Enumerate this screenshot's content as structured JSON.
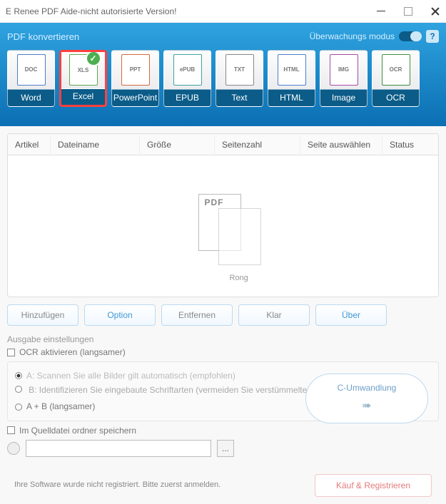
{
  "title_bar": {
    "title": "E Renee PDF Aide-nicht autorisierte Version!"
  },
  "ribbon": {
    "title": "PDF konvertieren",
    "monitor_label": "Überwachungs modus",
    "help_icon": "?",
    "tiles": [
      {
        "label": "Word",
        "short": "DOC"
      },
      {
        "label": "Excel",
        "short": "XLS",
        "selected": true
      },
      {
        "label": "PowerPoint",
        "short": "PPT"
      },
      {
        "label": "EPUB",
        "short": "ePUB"
      },
      {
        "label": "Text",
        "short": "TXT"
      },
      {
        "label": "HTML",
        "short": "HTML"
      },
      {
        "label": "Image",
        "short": "IMG"
      },
      {
        "label": "OCR",
        "short": "OCR"
      }
    ]
  },
  "table": {
    "headers": {
      "article": "Artikel",
      "filename": "Dateiname",
      "size": "Größe",
      "pagecount": "Seitenzahl",
      "selectpage": "Seite auswählen",
      "status": "Status"
    },
    "placeholder_text": "Rong",
    "pdf_tag": "PDF"
  },
  "buttons": {
    "add": "Hinzufügen",
    "option": "Option",
    "remove": "Entfernen",
    "clear": "Klar",
    "about": "Über"
  },
  "output": {
    "heading": "Ausgabe einstellungen",
    "ocr_check": "OCR aktivieren (langsamer)",
    "opt_a": "A: Scannen Sie alle Bilder gilt automatisch (empfohlen)",
    "opt_b": "B: Identifizieren Sie eingebaute Schriftarten (vermeiden Sie verstümmelte Zeichen)",
    "opt_ab": "A + B (langsamer)",
    "save_src": "Im Quelldatei ordner speichern",
    "path_value": "",
    "browse": "...",
    "convert_label": "C-Umwandlung"
  },
  "register": {
    "text": "Ihre Software wurde nicht registriert. Bitte zuerst anmelden.",
    "button": "Käuf & Registrieren"
  }
}
